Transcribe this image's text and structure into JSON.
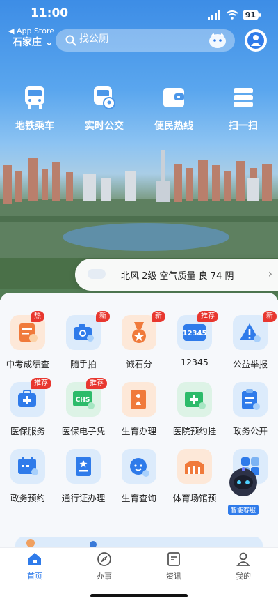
{
  "status": {
    "time": "11:00",
    "battery": "91",
    "back_label": "◀ App Store"
  },
  "header": {
    "city": "石家庄",
    "search_placeholder": "找公厕"
  },
  "quick_links": [
    {
      "label": "地铁乘车",
      "icon": "bus-icon"
    },
    {
      "label": "实时公交",
      "icon": "bus-location-icon"
    },
    {
      "label": "便民热线",
      "icon": "wallet-icon"
    },
    {
      "label": "扫一扫",
      "icon": "scan-icon"
    }
  ],
  "weather": {
    "text": "北风 2级 空气质量 良 74   阴"
  },
  "services": [
    [
      {
        "label": "中考成绩查",
        "badge": "热",
        "icon": "exam-certificate-icon"
      },
      {
        "label": "随手拍",
        "badge": "新",
        "icon": "camera-icon"
      },
      {
        "label": "诚石分",
        "badge": "新",
        "icon": "medal-icon"
      },
      {
        "label": "12345",
        "badge": "推荐",
        "icon": "hotline-card-icon",
        "icon_text": "12345"
      },
      {
        "label": "公益举报",
        "badge": "新",
        "icon": "warning-icon"
      }
    ],
    [
      {
        "label": "医保服务",
        "badge": "推荐",
        "icon": "medical-kit-icon"
      },
      {
        "label": "医保电子凭",
        "badge": "推荐",
        "icon": "chs-card-icon",
        "icon_text": "CHS"
      },
      {
        "label": "生育办理",
        "badge": "",
        "icon": "maternity-doc-icon"
      },
      {
        "label": "医院预约挂",
        "badge": "",
        "icon": "hospital-calendar-icon"
      },
      {
        "label": "政务公开",
        "badge": "",
        "icon": "clipboard-icon"
      }
    ],
    [
      {
        "label": "政务预约",
        "badge": "",
        "icon": "calendar-clock-icon"
      },
      {
        "label": "通行证办理",
        "badge": "",
        "icon": "pass-document-icon"
      },
      {
        "label": "生育查询",
        "badge": "",
        "icon": "baby-face-icon"
      },
      {
        "label": "体育场馆预",
        "badge": "",
        "icon": "stadium-icon"
      },
      {
        "label": "",
        "badge": "",
        "icon": "app-grid-icon"
      }
    ]
  ],
  "assistant": {
    "label": "智能客服"
  },
  "tabs": [
    {
      "label": "首页",
      "active": true
    },
    {
      "label": "办事",
      "active": false
    },
    {
      "label": "资讯",
      "active": false
    },
    {
      "label": "我的",
      "active": false
    }
  ],
  "colors": {
    "accent": "#2f7bea",
    "badge": "#e8372f",
    "panel": "#f6f8fb"
  }
}
